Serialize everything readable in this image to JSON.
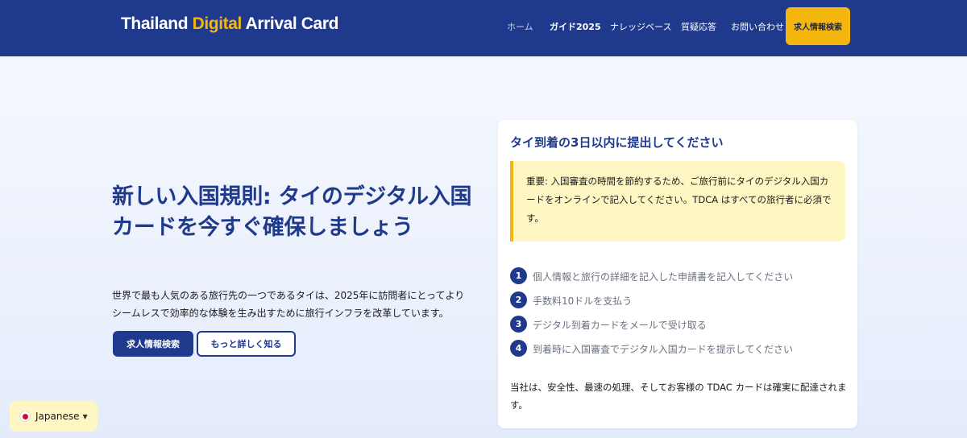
{
  "header": {
    "logo": {
      "part1": "Thailand ",
      "part2": "Digital",
      "part3": " Arrival Card"
    },
    "nav": [
      "ホーム",
      "ガイド2025",
      "ナレッジベース",
      "質疑応答",
      "お問い合わせ"
    ],
    "cta": "求人情報検索"
  },
  "hero": {
    "title": "新しい入国規則: タイのデジタル入国カードを今すぐ確保しましょう",
    "text": "世界で最も人気のある旅行先の一つであるタイは、2025年に訪問者にとってよりシームレスで効率的な体験を生み出すために旅行インフラを改革しています。",
    "primary_button": "求人情報検索",
    "secondary_button": "もっと詳しく知る"
  },
  "card": {
    "title": "タイ到着の3日以内に提出してください",
    "notice": "重要: 入国審査の時間を節約するため、ご旅行前にタイのデジタル入国カードをオンラインで記入してください。TDCA はすべての旅行者に必須です。",
    "steps": [
      {
        "num": "1",
        "text": "個人情報と旅行の詳細を記入した申請書を記入してください"
      },
      {
        "num": "2",
        "text": "手数料10ドルを支払う"
      },
      {
        "num": "3",
        "text": "デジタル到着カードをメールで受け取る"
      },
      {
        "num": "4",
        "text": "到着時に入国審査でデジタル入国カードを提示してください"
      }
    ],
    "footer": "当社は、安全性、最速の処理、そしてお客様の TDAC カードは確実に配達されます。"
  },
  "language": {
    "label": "Japanese",
    "caret": "▼"
  }
}
